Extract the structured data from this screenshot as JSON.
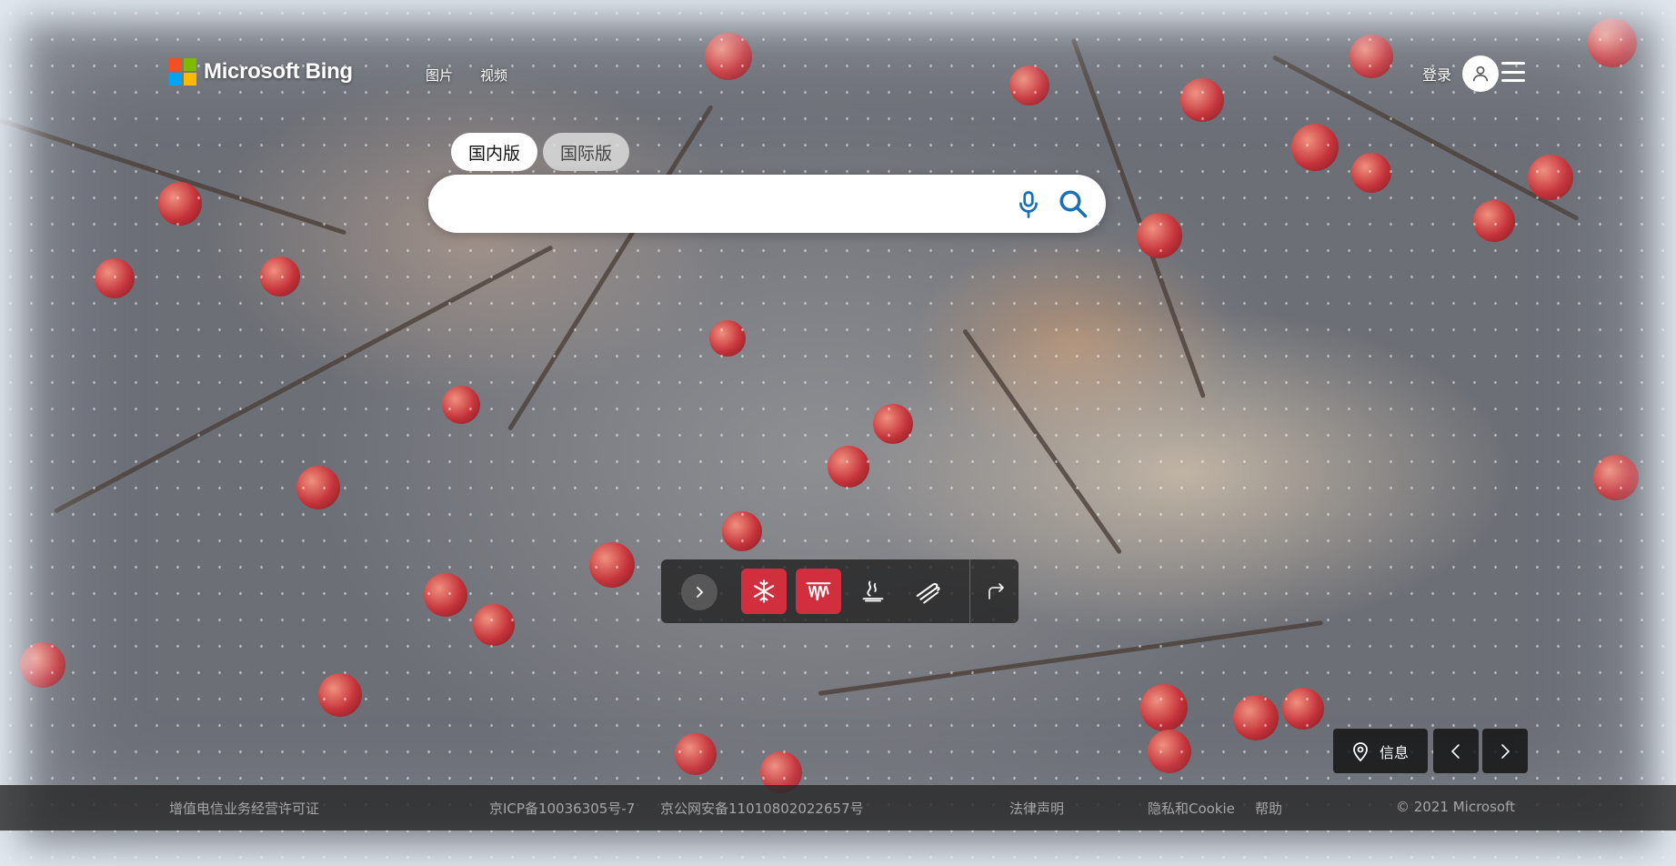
{
  "header": {
    "logo_text": "Microsoft Bing",
    "nav": [
      {
        "label": "图片"
      },
      {
        "label": "视频"
      }
    ],
    "login_label": "登录"
  },
  "search": {
    "tabs": [
      {
        "label": "国内版",
        "active": true
      },
      {
        "label": "国际版",
        "active": false
      }
    ],
    "input_value": "",
    "placeholder": ""
  },
  "toolbar": {
    "buttons": [
      {
        "icon": "chevron-right-icon"
      },
      {
        "icon": "snowflake-icon",
        "active": true
      },
      {
        "icon": "icicles-icon",
        "active": true
      },
      {
        "icon": "steam-icon"
      },
      {
        "icon": "wind-icon"
      },
      {
        "icon": "share-icon"
      }
    ]
  },
  "image_nav": {
    "info_label": "信息"
  },
  "footer": {
    "items": [
      "增值电信业务经营许可证",
      "京ICP备10036305号-7",
      "京公网安备11010802022657号",
      "法律声明",
      "隐私和Cookie",
      "帮助",
      "© 2021 Microsoft"
    ]
  },
  "colors": {
    "accent_red": "#d12e3e",
    "footer_bg": "#282828",
    "search_bg": "#ffffff"
  }
}
